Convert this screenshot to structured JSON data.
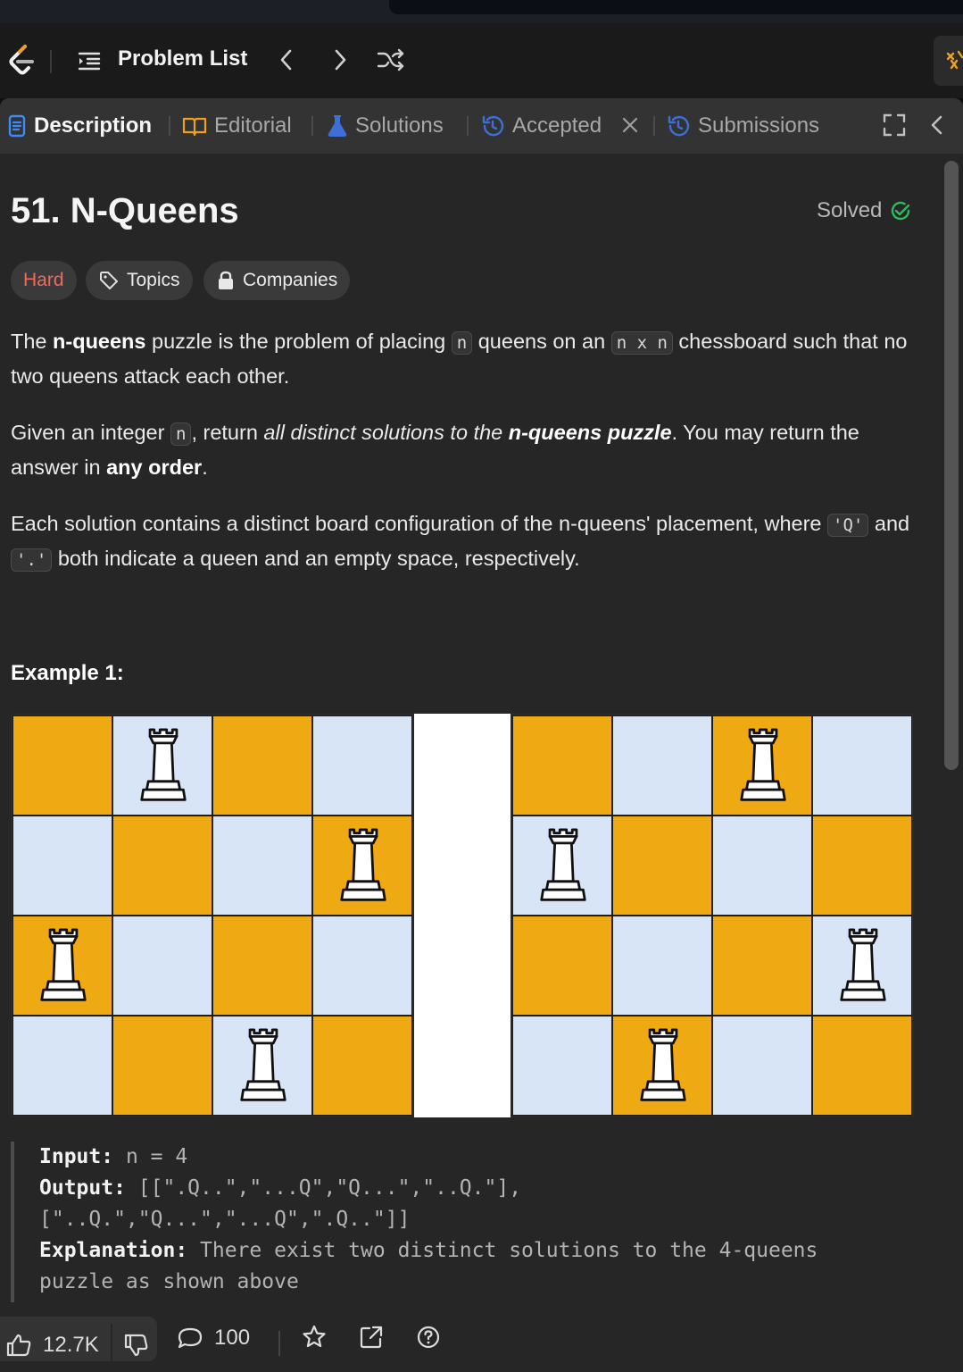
{
  "navbar": {
    "title": "Problem List"
  },
  "tabs": [
    {
      "label": "Description",
      "icon": "description-icon",
      "active": true
    },
    {
      "label": "Editorial",
      "icon": "book-icon"
    },
    {
      "label": "Solutions",
      "icon": "flask-icon"
    },
    {
      "label": "Accepted",
      "icon": "history-icon"
    },
    {
      "label": "Submissions",
      "icon": "history-icon"
    }
  ],
  "problem": {
    "title": "51. N-Queens",
    "status": "Solved",
    "tags": {
      "difficulty": "Hard",
      "topics": "Topics",
      "companies": "Companies"
    },
    "p1": {
      "a": "The ",
      "b": "n-queens",
      "c": " puzzle is the problem of placing ",
      "code1": "n",
      "d": " queens on an ",
      "code2": "n x n",
      "e": " chessboard such that no two queens attack each other."
    },
    "p2": {
      "a": "Given an integer ",
      "code1": "n",
      "b": ", return ",
      "c": "all distinct solutions to the ",
      "d": "n-queens puzzle",
      "e": ". You may return the answer in ",
      "f": "any order",
      "g": "."
    },
    "p3": {
      "a": "Each solution contains a distinct board configuration of the n-queens' placement, where ",
      "code1": "'Q'",
      "b": " and ",
      "code2": "'.'",
      "c": " both indicate a queen and an empty space, respectively."
    },
    "example_title": "Example 1:",
    "example": {
      "input_label": "Input:",
      "input_value": " n = 4",
      "output_label": "Output:",
      "output_value1": " [[\".Q..\",\"...Q\",\"Q...\",\"..Q.\"],",
      "output_value2": "[\"..Q.\",\"Q...\",\"...Q\",\".Q..\"]]",
      "explanation_label": "Explanation:",
      "explanation_value1": " There exist two distinct solutions to the 4-queens",
      "explanation_value2": "puzzle as shown above"
    },
    "boards": [
      [
        ".Q..",
        "...Q",
        "Q...",
        "..Q."
      ],
      [
        "..Q.",
        "Q...",
        "...Q",
        ".Q.."
      ]
    ]
  },
  "footer": {
    "likes": "12.7K",
    "comments": "100"
  },
  "colors": {
    "hard": "#f26a5c",
    "solved": "#2cbb5d",
    "board_dark": "#efa912",
    "board_light": "#d7e5f7"
  }
}
